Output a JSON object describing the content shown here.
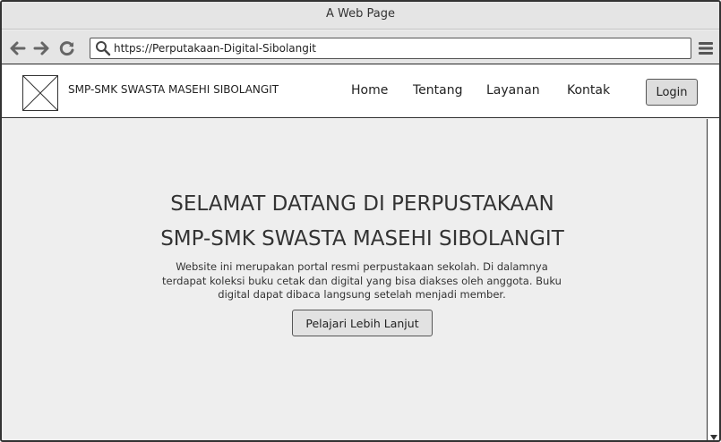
{
  "browser": {
    "window_title": "A Web Page",
    "address": "https://Perputakaan-Digital-Sibolangit",
    "icons": [
      "back-arrow-icon",
      "forward-arrow-icon",
      "reload-icon",
      "search-icon",
      "hamburger-menu-icon"
    ]
  },
  "header": {
    "site_name": "SMP-SMK SWASTA MASEHI SIBOLANGIT",
    "nav": [
      "Home",
      "Tentang",
      "Layanan",
      "Kontak"
    ],
    "login_label": "Login"
  },
  "hero": {
    "title_line1": "SELAMAT DATANG DI PERPUSTAKAAN",
    "title_line2": "SMP-SMK SWASTA MASEHI SIBOLANGIT",
    "description": "Website ini merupakan portal resmi perpustakaan sekolah. Di dalamnya terdapat koleksi buku cetak dan digital yang bisa diakses oleh anggota. Buku digital dapat dibaca langsung setelah menjadi member.",
    "cta_label": "Pelajari Lebih Lanjut"
  }
}
